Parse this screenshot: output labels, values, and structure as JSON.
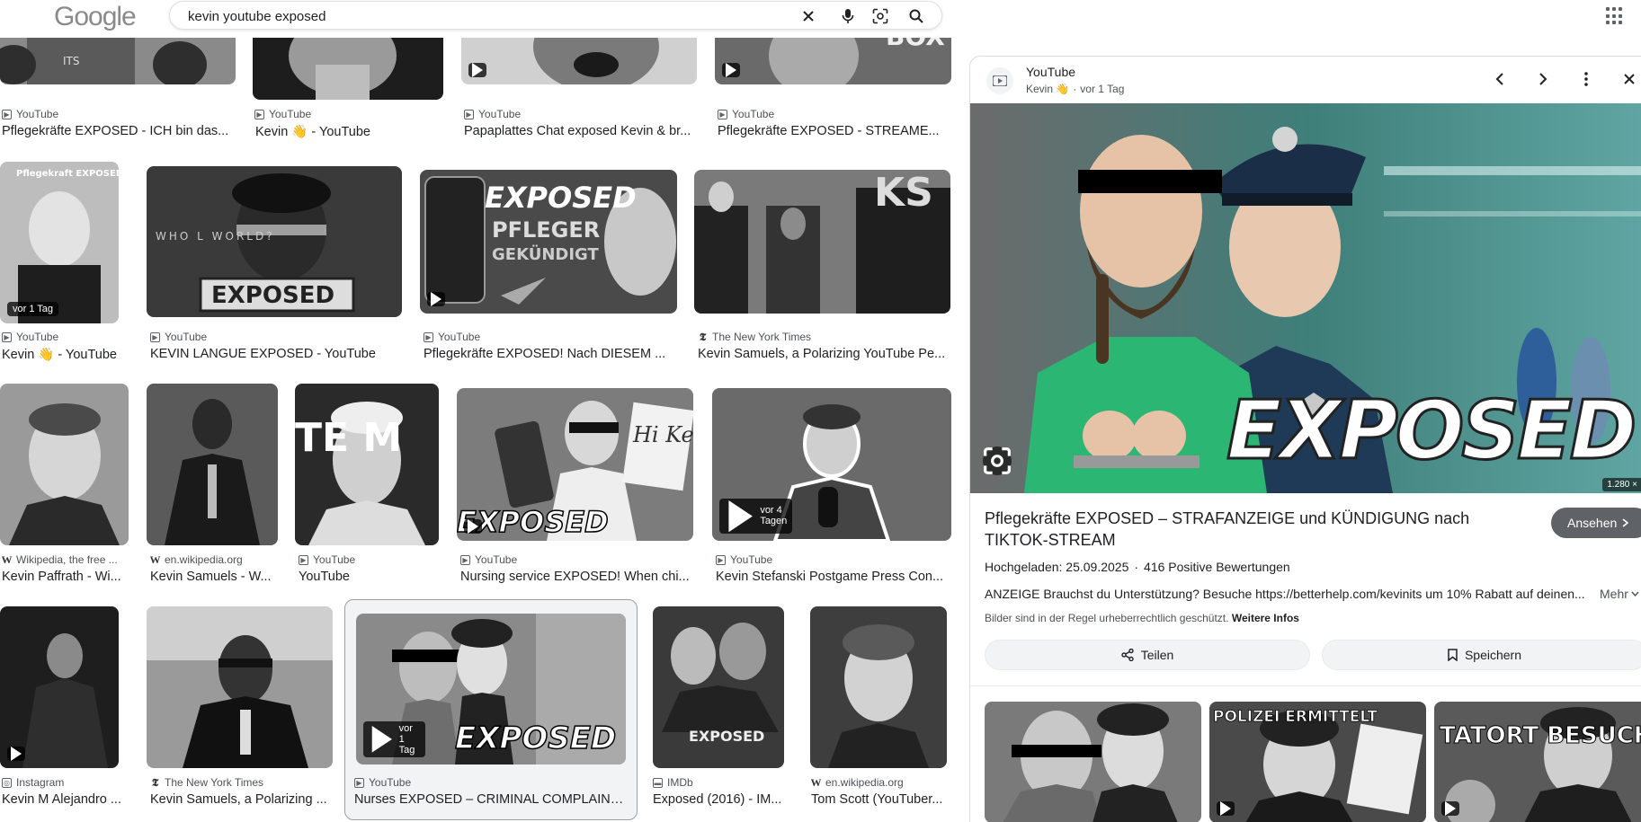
{
  "header": {
    "logo": "Google",
    "query": "kevin youtube exposed"
  },
  "results": [
    {
      "source": "YouTube",
      "title": "Pflegekräfte EXPOSED - ICH bin das...",
      "icon": "youtube-icon"
    },
    {
      "source": "YouTube",
      "title": "Kevin 👋 - YouTube",
      "icon": "youtube-icon"
    },
    {
      "source": "YouTube",
      "title": "Papaplattes Chat exposed Kevin & br...",
      "icon": "youtube-icon"
    },
    {
      "source": "YouTube",
      "title": "Pflegekräfte EXPOSED - STREAME...",
      "icon": "youtube-icon"
    },
    {
      "source": "YouTube",
      "title": "Kevin 👋 - YouTube",
      "icon": "youtube-icon",
      "badge": "vor 1 Tag"
    },
    {
      "source": "YouTube",
      "title": "KEVIN LANGUE EXPOSED - YouTube",
      "icon": "youtube-icon"
    },
    {
      "source": "YouTube",
      "title": "Pflegekräfte EXPOSED! Nach DIESEM ...",
      "icon": "youtube-icon"
    },
    {
      "source": "The New York Times",
      "title": "Kevin Samuels, a Polarizing YouTube Pe...",
      "icon": "nyt-icon"
    },
    {
      "source": "Wikipedia, the free ...",
      "title": "Kevin Paffrath - Wi...",
      "icon": "wikipedia-icon"
    },
    {
      "source": "en.wikipedia.org",
      "title": "Kevin Samuels - W...",
      "icon": "wikipedia-icon"
    },
    {
      "source": "YouTube",
      "title": "YouTube",
      "icon": "youtube-icon"
    },
    {
      "source": "YouTube",
      "title": "Nursing service EXPOSED! When chi...",
      "icon": "youtube-icon"
    },
    {
      "source": "YouTube",
      "title": "Kevin Stefanski Postgame Press Con...",
      "icon": "youtube-icon",
      "badge": "vor 4 Tagen"
    },
    {
      "source": "Instagram",
      "title": "Kevin M Alejandro ...",
      "icon": "instagram-icon"
    },
    {
      "source": "The New York Times",
      "title": "Kevin Samuels, a Polarizing ...",
      "icon": "nyt-icon"
    },
    {
      "source": "YouTube",
      "title": "Nurses EXPOSED – CRIMINAL COMPLAINT...",
      "icon": "youtube-icon",
      "badge": "vor 1 Tag"
    },
    {
      "source": "IMDb",
      "title": "Exposed (2016) - IM...",
      "icon": "imdb-icon"
    },
    {
      "source": "en.wikipedia.org",
      "title": "Tom Scott (YouTuber...",
      "icon": "wikipedia-icon"
    }
  ],
  "thumb_text": {
    "itsbox": "ITS",
    "row2_sign": "EXPOSED",
    "row2_tag": "Pflegekraft EXPOSED",
    "row2_big1": "EXPOSED",
    "row2_big2": "PFLEGER",
    "row2_big3": "GEKÜNDIGT",
    "row2_who": "WHO L    WORLD?",
    "row3_team": "TE   M",
    "row3_exposed": "EXPOSED",
    "row3_sign": "Hi Kevin",
    "row4_exposed": "EXPOSED",
    "row4_movie": "EXPOSED",
    "row2_ks": "KS"
  },
  "preview": {
    "site": "YouTube",
    "author": "Kevin 👋",
    "age": "vor 1 Tag",
    "image_text": "EXPOSED",
    "dimensions": "1.280 ×",
    "title": "Pflegekräfte EXPOSED – STRAFANZEIGE und KÜNDIGUNG nach TIKTOK-STREAM",
    "visit_label": "Ansehen",
    "uploaded": "Hochgeladen: 25.09.2025",
    "ratings": "416 Positive Bewertungen",
    "description": "ANZEIGE Brauchst du Unterstützung? Besuche https://betterhelp.com/kevinits um 10% Rabatt auf deinen...",
    "more_label": "Mehr",
    "copyright_text": "Bilder sind in der Regel urheberrechtlich geschützt.",
    "copyright_link": "Weitere Infos",
    "share_label": "Teilen",
    "save_label": "Speichern",
    "related_text": [
      "",
      "POLIZEI ERMITTELT",
      "TATORT BESUCHT"
    ]
  },
  "colors": {
    "accent_green": "#2bb673",
    "police_blue": "#1f3a57",
    "button_gray": "#5f6368"
  }
}
